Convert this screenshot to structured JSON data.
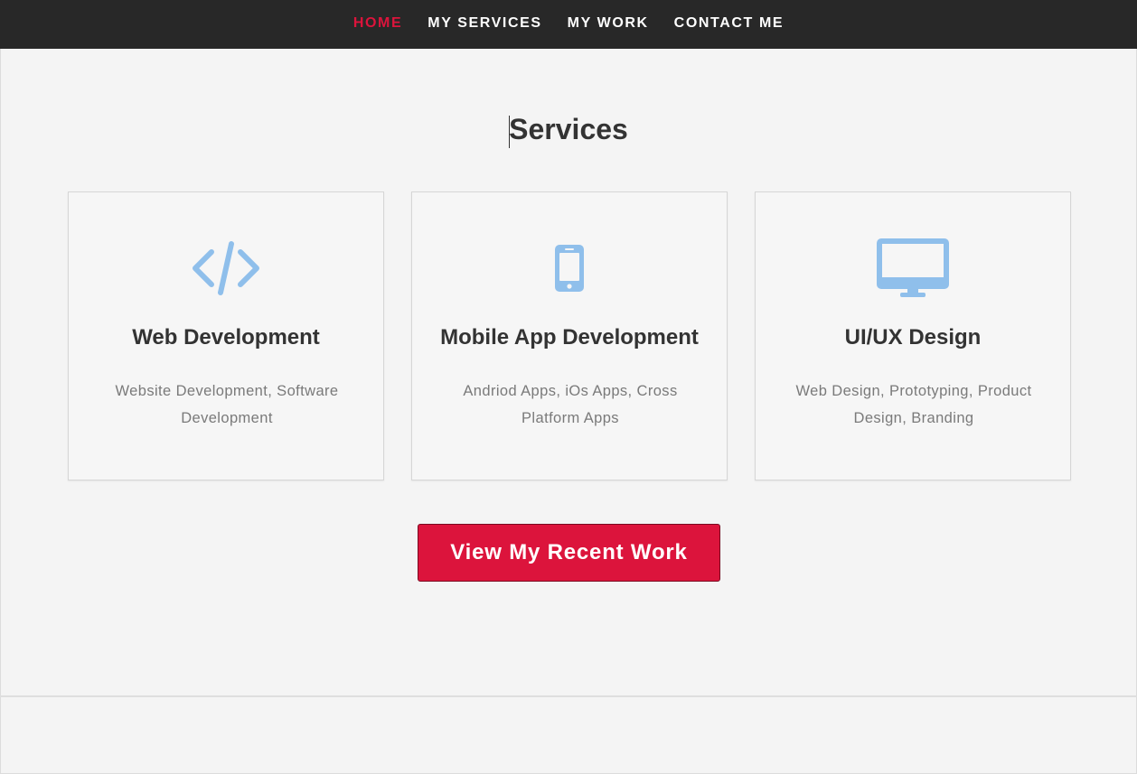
{
  "nav": {
    "items": [
      {
        "label": "HOME",
        "active": true
      },
      {
        "label": "MY SERVICES",
        "active": false
      },
      {
        "label": "MY WORK",
        "active": false
      },
      {
        "label": "CONTACT ME",
        "active": false
      }
    ]
  },
  "services": {
    "title": "Services",
    "cards": [
      {
        "icon": "code-icon",
        "title": "Web Development",
        "description": "Website Development, Software Development"
      },
      {
        "icon": "mobile-phone-icon",
        "title": "Mobile App Development",
        "description": "Andriod Apps, iOs Apps, Cross Platform Apps"
      },
      {
        "icon": "desktop-monitor-icon",
        "title": "UI/UX Design",
        "description": "Web Design, Prototyping, Product Design, Branding"
      }
    ]
  },
  "cta": {
    "label": "View My Recent Work"
  },
  "colors": {
    "navbar_bg": "#282828",
    "accent": "#dc143c",
    "icon": "#8fbfeb",
    "page_bg": "#f4f4f4"
  }
}
